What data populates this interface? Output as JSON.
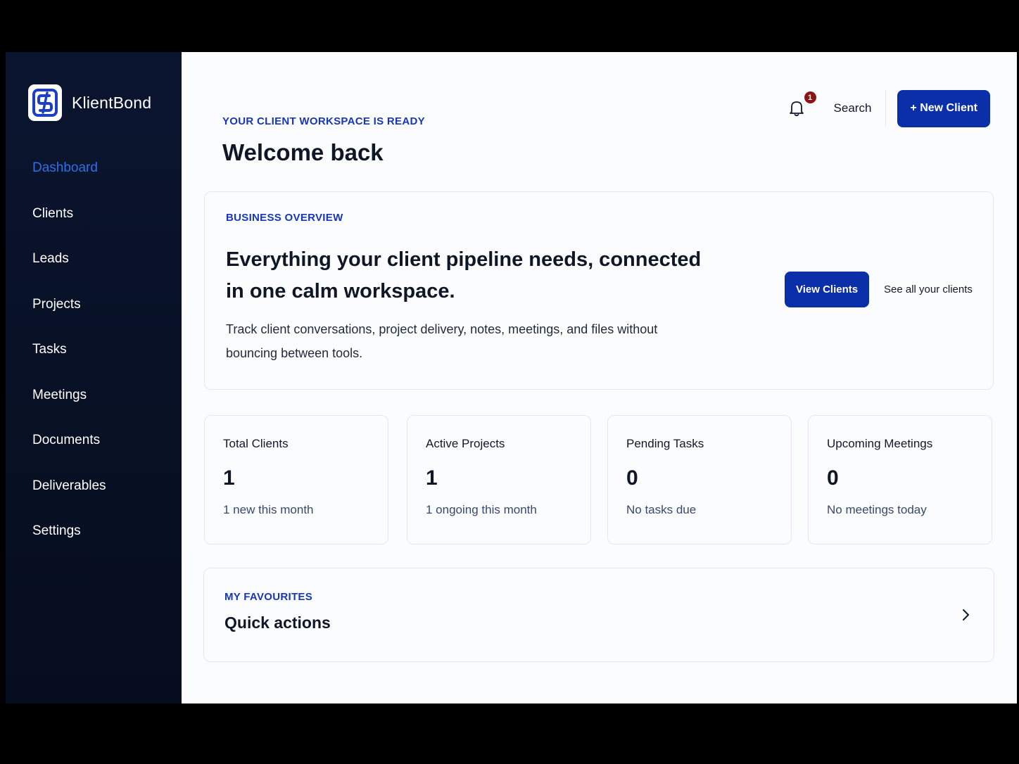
{
  "brand": {
    "name": "KlientBond",
    "logo_icon": "link-s-logo-icon"
  },
  "sidebar": {
    "items": [
      {
        "label": "Dashboard",
        "active": true
      },
      {
        "label": "Clients"
      },
      {
        "label": "Leads"
      },
      {
        "label": "Projects"
      },
      {
        "label": "Tasks"
      },
      {
        "label": "Meetings"
      },
      {
        "label": "Documents"
      },
      {
        "label": "Deliverables"
      },
      {
        "label": "Settings"
      }
    ]
  },
  "header": {
    "eyebrow": "YOUR CLIENT WORKSPACE IS READY",
    "title": "Welcome back",
    "notifications_count": "1",
    "search_label": "Search",
    "new_client_label": "+ New Client"
  },
  "overview": {
    "eyebrow": "BUSINESS OVERVIEW",
    "headline": "Everything your client pipeline needs, connected in one calm workspace.",
    "description": "Track client conversations, project delivery, notes, meetings, and files without bouncing between tools.",
    "primary_button": "View Clients",
    "secondary_link": "See all your clients"
  },
  "stats": [
    {
      "label": "Total Clients",
      "value": "1",
      "sub": "1 new this month"
    },
    {
      "label": "Active Projects",
      "value": "1",
      "sub": "1 ongoing this month"
    },
    {
      "label": "Pending Tasks",
      "value": "0",
      "sub": "No tasks due"
    },
    {
      "label": "Upcoming Meetings",
      "value": "0",
      "sub": "No meetings today"
    }
  ],
  "favourites": {
    "eyebrow": "MY FAVOURITES",
    "title": "Quick actions"
  },
  "colors": {
    "sidebar_bg": "#081126",
    "accent": "#0b2fa8",
    "active_nav": "#2f6fe8",
    "eyebrow": "#1736b8",
    "badge": "#8b1414"
  }
}
